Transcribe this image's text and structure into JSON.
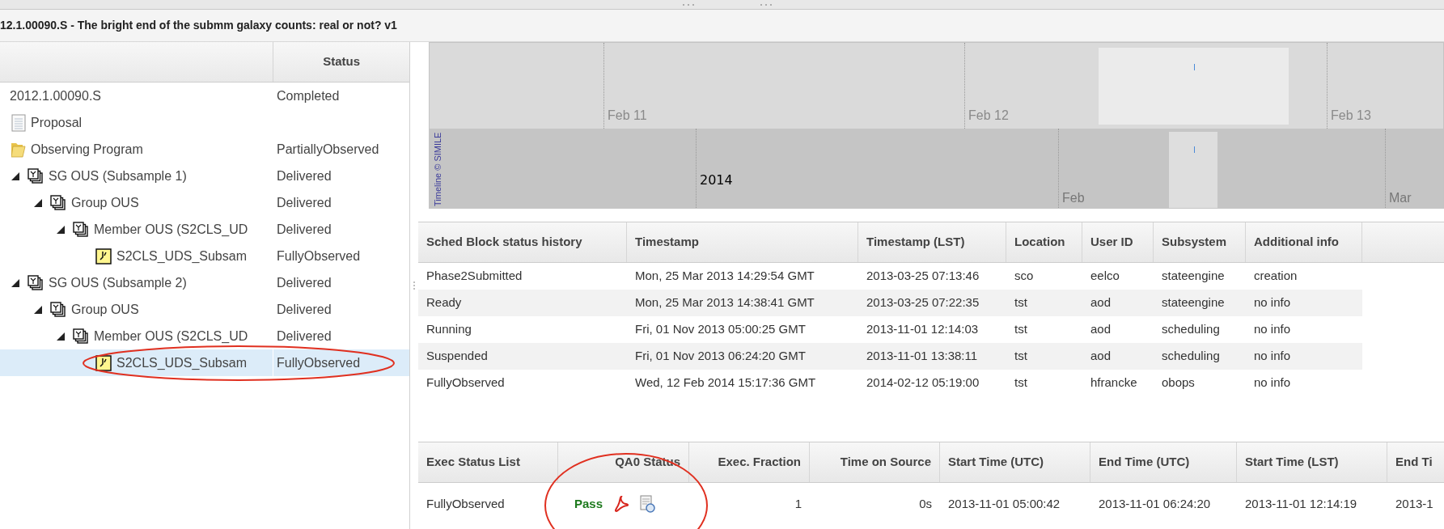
{
  "title": "12.1.00090.S - The bright end of the submm galaxy counts: real or not? v1",
  "tree": {
    "status_header": "Status",
    "items": [
      {
        "label": "2012.1.00090.S",
        "status": "Completed",
        "kind": "plain",
        "selected": false
      },
      {
        "label": "Proposal",
        "kind": "document",
        "selected": false
      },
      {
        "label": "Observing Program",
        "status": "PartiallyObserved",
        "kind": "folder",
        "selected": false
      },
      {
        "label": "SG OUS (Subsample 1)",
        "status": "Delivered",
        "kind": "group",
        "expanded": true,
        "selected": false,
        "children": [
          {
            "label": "Group OUS",
            "status": "Delivered",
            "kind": "group",
            "expanded": true,
            "selected": false,
            "children": [
              {
                "label": "Member OUS (S2CLS_UD",
                "status": "Delivered",
                "kind": "group",
                "expanded": true,
                "selected": false,
                "children": [
                  {
                    "label": "S2CLS_UDS_Subsam",
                    "status": "FullyObserved",
                    "kind": "block",
                    "selected": false
                  }
                ]
              }
            ]
          }
        ]
      },
      {
        "label": "SG OUS (Subsample 2)",
        "status": "Delivered",
        "kind": "group",
        "expanded": true,
        "selected": false,
        "children": [
          {
            "label": "Group OUS",
            "status": "Delivered",
            "kind": "group",
            "expanded": true,
            "selected": false,
            "children": [
              {
                "label": "Member OUS (S2CLS_UD",
                "status": "Delivered",
                "kind": "group",
                "expanded": true,
                "selected": false,
                "children": [
                  {
                    "label": "S2CLS_UDS_Subsam",
                    "status": "FullyObserved",
                    "kind": "block",
                    "selected": true
                  }
                ]
              }
            ]
          }
        ]
      }
    ]
  },
  "timeline": {
    "credit": "Timeline © SIMILE",
    "upper_labels": [
      "Feb 11",
      "Feb 12",
      "Feb 13"
    ],
    "lower_labels": [
      {
        "text": "2014",
        "kind": "year"
      },
      {
        "text": "Feb",
        "kind": "month"
      },
      {
        "text": "Mar",
        "kind": "month"
      }
    ]
  },
  "status_history": {
    "columns": [
      "Sched Block status history",
      "Timestamp",
      "Timestamp (LST)",
      "Location",
      "User ID",
      "Subsystem",
      "Additional info"
    ],
    "rows": [
      [
        "Phase2Submitted",
        "Mon, 25 Mar 2013 14:29:54 GMT",
        "2013-03-25 07:13:46",
        "sco",
        "eelco",
        "stateengine",
        "creation"
      ],
      [
        "Ready",
        "Mon, 25 Mar 2013 14:38:41 GMT",
        "2013-03-25 07:22:35",
        "tst",
        "aod",
        "stateengine",
        "no info"
      ],
      [
        "Running",
        "Fri, 01 Nov 2013 05:00:25 GMT",
        "2013-11-01 12:14:03",
        "tst",
        "aod",
        "scheduling",
        "no info"
      ],
      [
        "Suspended",
        "Fri, 01 Nov 2013 06:24:20 GMT",
        "2013-11-01 13:38:11",
        "tst",
        "aod",
        "scheduling",
        "no info"
      ],
      [
        "FullyObserved",
        "Wed, 12 Feb 2014 15:17:36 GMT",
        "2014-02-12 05:19:00",
        "tst",
        "hfrancke",
        "obops",
        "no info"
      ]
    ]
  },
  "exec_status": {
    "columns": [
      "Exec Status List",
      "QA0 Status",
      "Exec. Fraction",
      "Time on Source",
      "Start Time (UTC)",
      "End Time (UTC)",
      "Start Time (LST)",
      "End Ti"
    ],
    "rows": [
      {
        "status": "FullyObserved",
        "qa0": "Pass",
        "fraction": "1",
        "time_on_source": "0s",
        "start_utc": "2013-11-01 05:00:42",
        "end_utc": "2013-11-01 06:24:20",
        "start_lst": "2013-11-01 12:14:19",
        "end_lst": "2013-1"
      }
    ]
  },
  "annotations": [
    {
      "kind": "ellipse"
    },
    {
      "kind": "ellipse"
    }
  ]
}
